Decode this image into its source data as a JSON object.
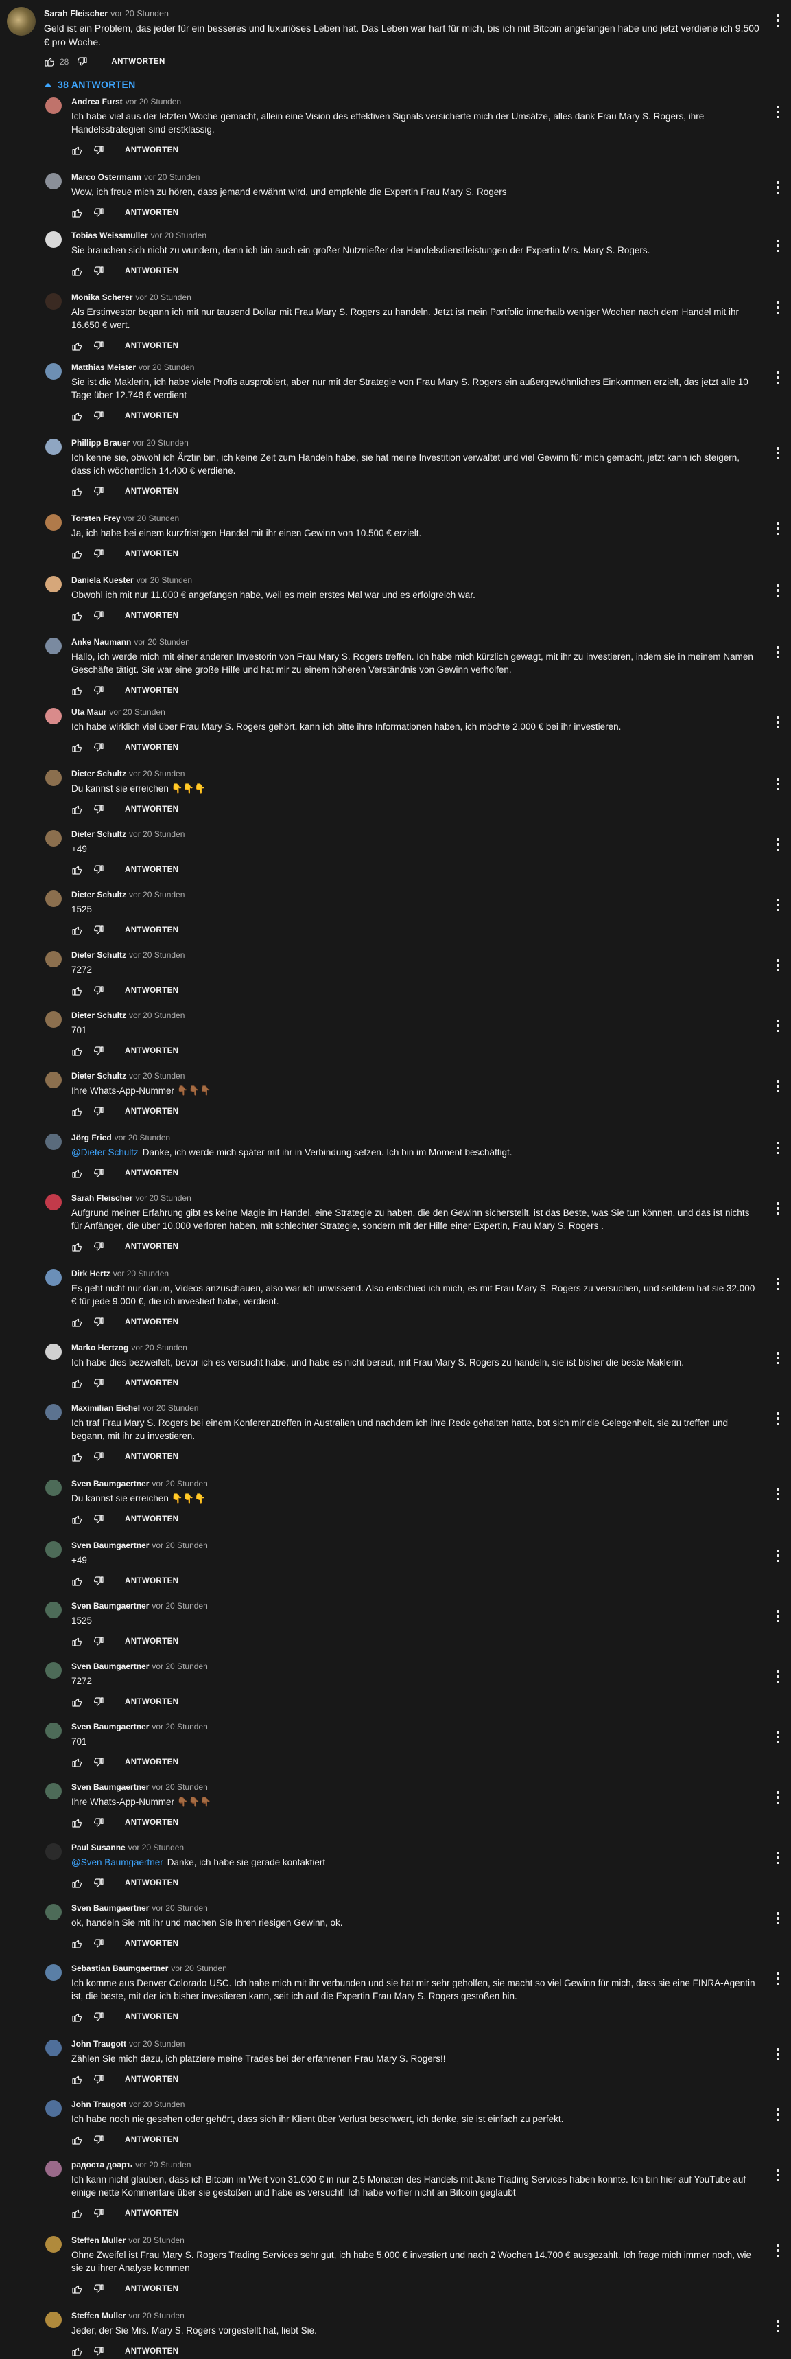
{
  "top_comment": {
    "author": "Sarah Fleischer",
    "time": "vor 20 Stunden",
    "text": "Geld ist ein Problem, das jeder für ein besseres und luxuriöses Leben hat.  Das Leben war hart für mich, bis ich mit Bitcoin angefangen habe und jetzt verdiene ich 9.500 € pro Woche.",
    "likes": "28",
    "reply_label": "ANTWORTEN"
  },
  "replies_toggle": "38 ANTWORTEN",
  "reply_label": "ANTWORTEN",
  "replies": [
    {
      "author": "Andrea Furst",
      "time": "vor 20 Stunden",
      "text": "Ich habe viel aus der letzten Woche gemacht, allein eine Vision des effektiven Signals versicherte mich der Umsätze, alles dank Frau Mary S. Rogers, ihre Handelsstrategien sind erstklassig.",
      "avatar_color": "#c0736b"
    },
    {
      "author": "Marco Ostermann",
      "time": "vor 20 Stunden",
      "text": "Wow, ich freue mich zu hören, dass jemand erwähnt wird, und empfehle die Expertin Frau Mary S. Rogers",
      "avatar_color": "#8a8f98"
    },
    {
      "author": "Tobias Weissmuller",
      "time": "vor 20 Stunden",
      "text": "Sie brauchen sich nicht zu wundern, denn ich bin auch ein großer Nutznießer der Handelsdienstleistungen der Expertin Mrs. Mary S. Rogers.",
      "avatar_color": "#d9d9d9"
    },
    {
      "author": "Monika Scherer",
      "time": "vor 20 Stunden",
      "text": "Als Erstinvestor begann ich mit nur tausend Dollar mit Frau Mary S. Rogers zu handeln. Jetzt ist mein Portfolio innerhalb weniger Wochen nach dem Handel mit ihr 16.650 € wert.",
      "avatar_color": "#3a2a22"
    },
    {
      "author": "Matthias Meister",
      "time": "vor 20 Stunden",
      "text": "Sie ist die Maklerin, ich habe viele Profis ausprobiert, aber nur mit der Strategie von Frau Mary S. Rogers ein außergewöhnliches Einkommen erzielt, das jetzt alle 10 Tage über 12.748 € verdient",
      "avatar_color": "#6d8fb3"
    },
    {
      "author": "Phillipp Brauer",
      "time": "vor 20 Stunden",
      "text": "Ich kenne sie, obwohl ich Ärztin bin, ich keine Zeit zum Handeln habe, sie hat meine Investition verwaltet und viel Gewinn für mich gemacht, jetzt kann ich steigern, dass ich wöchentlich 14.400 € verdiene.",
      "avatar_color": "#8fa6c2"
    },
    {
      "author": "Torsten Frey",
      "time": "vor 20 Stunden",
      "text": "Ja, ich habe bei einem kurzfristigen Handel mit ihr einen Gewinn von 10.500 € erzielt.",
      "avatar_color": "#b07a4a"
    },
    {
      "author": "Daniela Kuester",
      "time": "vor 20 Stunden",
      "text": "Obwohl ich mit nur 11.000 € angefangen habe, weil es mein erstes Mal war und es erfolgreich war.",
      "avatar_color": "#d6a77a"
    },
    {
      "author": "Anke Naumann",
      "time": "vor 20 Stunden",
      "text": "Hallo, ich werde mich mit einer anderen Investorin von Frau Mary S. Rogers treffen. Ich habe mich kürzlich gewagt, mit ihr zu investieren, indem sie in meinem Namen Geschäfte tätigt. Sie war eine große Hilfe und hat mir zu einem höheren Verständnis von Gewinn verholfen.",
      "avatar_color": "#7a8aa0"
    },
    {
      "author": "Uta Maur",
      "time": "vor 20 Stunden",
      "text": "Ich habe wirklich viel über Frau Mary S. Rogers gehört, kann ich bitte ihre Informationen haben, ich möchte 2.000 € bei ihr investieren.",
      "avatar_color": "#d98b8b"
    },
    {
      "author": "Dieter Schultz",
      "time": "vor 20 Stunden",
      "text": "Du kannst sie erreichen 👇👇👇",
      "avatar_color": "#8b6f4e"
    },
    {
      "author": "Dieter Schultz",
      "time": "vor 20 Stunden",
      "text": "+49",
      "avatar_color": "#8b6f4e"
    },
    {
      "author": "Dieter Schultz",
      "time": "vor 20 Stunden",
      "text": "1525",
      "avatar_color": "#8b6f4e"
    },
    {
      "author": "Dieter Schultz",
      "time": "vor 20 Stunden",
      "text": "7272",
      "avatar_color": "#8b6f4e"
    },
    {
      "author": "Dieter Schultz",
      "time": "vor 20 Stunden",
      "text": "701",
      "avatar_color": "#8b6f4e"
    },
    {
      "author": "Dieter Schultz",
      "time": "vor 20 Stunden",
      "text": "Ihre Whats-App-Nummer 👇🏾👇🏾👇🏾",
      "avatar_color": "#8b6f4e"
    },
    {
      "author": "Jörg Fried",
      "time": "vor 20 Stunden",
      "mention": "@Dieter Schultz",
      "text": "Danke, ich werde mich später mit ihr in Verbindung setzen. Ich bin im Moment beschäftigt.",
      "avatar_color": "#5a6b7c"
    },
    {
      "author": "Sarah Fleischer",
      "time": "vor 20 Stunden",
      "text": "Aufgrund meiner Erfahrung gibt es keine Magie im Handel, eine Strategie zu haben, die den Gewinn sicherstellt, ist das Beste, was Sie tun können, und das ist nichts für Anfänger, die über 10.000 verloren haben, mit schlechter Strategie, sondern mit der Hilfe einer Expertin, Frau Mary S. Rogers  .",
      "avatar_color": "#c23a4a"
    },
    {
      "author": "Dirk Hertz",
      "time": "vor 20 Stunden",
      "text": "Es geht nicht nur darum, Videos anzuschauen, also war ich unwissend. Also entschied ich mich, es mit Frau Mary S. Rogers zu versuchen, und seitdem hat sie 32.000 € für jede 9.000 €, die ich investiert habe, verdient.",
      "avatar_color": "#6b8fb8"
    },
    {
      "author": "Marko Hertzog",
      "time": "vor 20 Stunden",
      "text": "Ich habe dies bezweifelt, bevor ich es versucht habe, und habe es nicht bereut, mit Frau Mary S. Rogers zu handeln, sie ist bisher die beste Maklerin.",
      "avatar_color": "#d0d0d0"
    },
    {
      "author": "Maximilian Eichel",
      "time": "vor 20 Stunden",
      "text": "Ich traf Frau Mary S. Rogers bei einem Konferenztreffen in Australien und nachdem ich ihre Rede gehalten hatte, bot sich mir die Gelegenheit, sie zu treffen und begann, mit ihr zu investieren.",
      "avatar_color": "#5c7390"
    },
    {
      "author": "Sven Baumgaertner",
      "time": "vor 20 Stunden",
      "text": "Du kannst sie erreichen 👇👇👇",
      "avatar_color": "#4d6b58"
    },
    {
      "author": "Sven Baumgaertner",
      "time": "vor 20 Stunden",
      "text": "+49",
      "avatar_color": "#4d6b58"
    },
    {
      "author": "Sven Baumgaertner",
      "time": "vor 20 Stunden",
      "text": "1525",
      "avatar_color": "#4d6b58"
    },
    {
      "author": "Sven Baumgaertner",
      "time": "vor 20 Stunden",
      "text": "7272",
      "avatar_color": "#4d6b58"
    },
    {
      "author": "Sven Baumgaertner",
      "time": "vor 20 Stunden",
      "text": "701",
      "avatar_color": "#4d6b58"
    },
    {
      "author": "Sven Baumgaertner",
      "time": "vor 20 Stunden",
      "text": "Ihre Whats-App-Nummer 👇🏾👇🏾👇🏾",
      "avatar_color": "#4d6b58"
    },
    {
      "author": "Paul Susanne",
      "time": "vor 20 Stunden",
      "mention": "@Sven Baumgaertner",
      "text": "Danke, ich habe sie gerade kontaktiert",
      "avatar_color": "#2b2b2b"
    },
    {
      "author": "Sven Baumgaertner",
      "time": "vor 20 Stunden",
      "text": "ok, handeln Sie mit ihr und machen Sie Ihren riesigen Gewinn, ok.",
      "avatar_color": "#4d6b58"
    },
    {
      "author": "Sebastian Baumgaertner",
      "time": "vor 20 Stunden",
      "text": "Ich komme aus Denver Colorado USC. Ich habe mich mit ihr verbunden und sie hat mir sehr geholfen, sie macht so viel Gewinn für mich, dass sie eine FINRA-Agentin ist, die beste, mit der ich bisher investieren kann, seit ich auf die Expertin Frau Mary S. Rogers gestoßen bin.",
      "avatar_color": "#5a7fa6"
    },
    {
      "author": "John Traugott",
      "time": "vor 20 Stunden",
      "text": "Zählen Sie mich dazu, ich platziere meine Trades bei der erfahrenen Frau Mary S. Rogers!!",
      "avatar_color": "#4f6f9a"
    },
    {
      "author": "John Traugott",
      "time": "vor 20 Stunden",
      "text": "Ich habe noch nie gesehen oder gehört, dass sich ihr Klient über Verlust beschwert, ich denke, sie ist einfach zu perfekt.",
      "avatar_color": "#4f6f9a"
    },
    {
      "author": "радоста доаръ",
      "time": "vor 20 Stunden",
      "text": "Ich kann nicht glauben, dass ich Bitcoin im Wert von 31.000 € in nur 2,5 Monaten des Handels mit Jane Trading Services haben konnte.  Ich bin hier auf YouTube auf einige nette Kommentare über sie gestoßen und habe es versucht!  Ich habe vorher nicht an Bitcoin geglaubt",
      "avatar_color": "#9a6a8a"
    },
    {
      "author": "Steffen Muller",
      "time": "vor 20 Stunden",
      "text": "Ohne Zweifel ist Frau Mary S. Rogers Trading Services sehr gut, ich habe 5.000 € investiert und nach 2 Wochen 14.700 € ausgezahlt.  Ich frage mich immer noch, wie sie zu ihrer Analyse kommen",
      "avatar_color": "#b08a3c"
    },
    {
      "author": "Steffen Muller",
      "time": "vor 20 Stunden",
      "text": "Jeder, der Sie Mrs. Mary S. Rogers vorgestellt hat, liebt Sie.",
      "avatar_color": "#b08a3c"
    }
  ]
}
